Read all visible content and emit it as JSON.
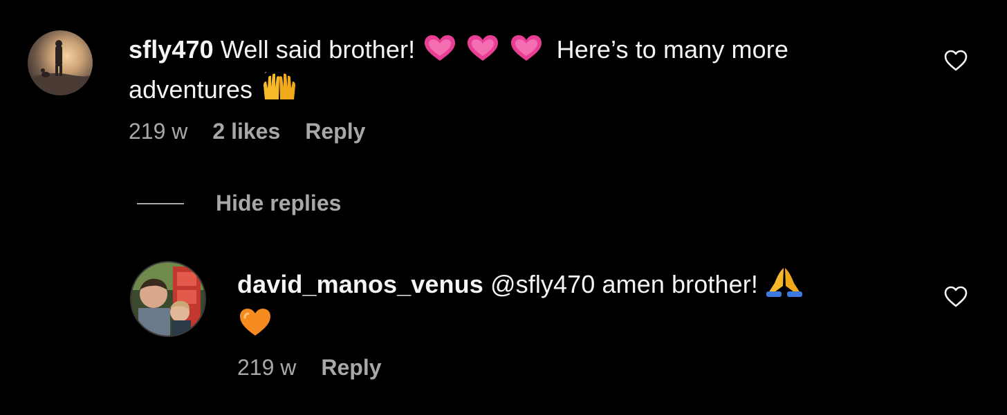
{
  "comments": [
    {
      "username": "sfly470",
      "text_before": "Well said brother!",
      "text_after": "Here’s to many more",
      "text_line2": "adventures",
      "time": "219 w",
      "likes": "2 likes",
      "reply_label": "Reply"
    }
  ],
  "hide_replies_label": "Hide replies",
  "replies": [
    {
      "username": "david_manos_venus",
      "mention": "@sfly470",
      "text": "amen brother!",
      "time": "219 w",
      "reply_label": "Reply"
    }
  ],
  "colors": {
    "background": "#000000",
    "text": "#f5f5f5",
    "secondary_text": "#a8a8a8"
  },
  "icons": [
    "heart-outline-icon",
    "pink-heart-emoji",
    "raising-hands-emoji",
    "folded-hands-emoji",
    "orange-heart-emoji"
  ]
}
